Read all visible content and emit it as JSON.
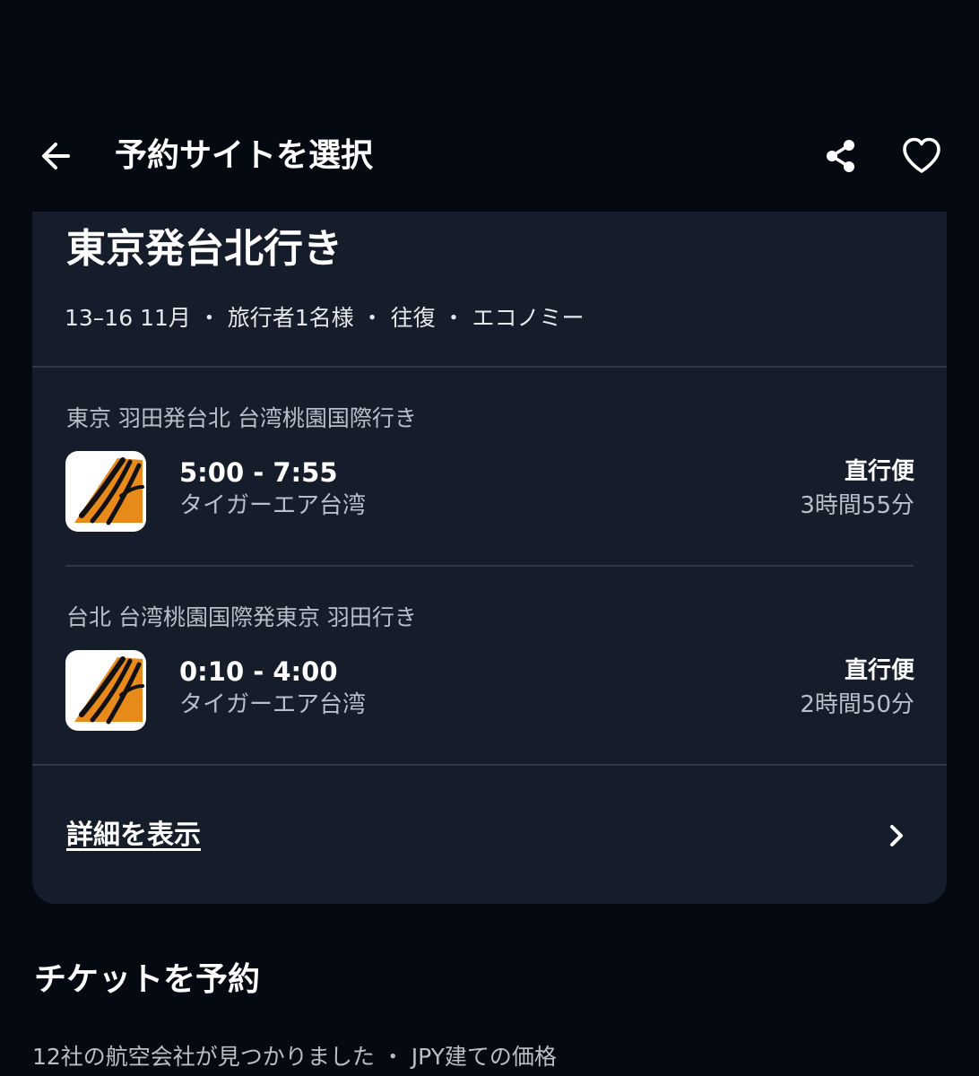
{
  "header": {
    "title": "予約サイトを選択",
    "back_icon": "arrow-left-icon",
    "share_icon": "share-icon",
    "favorite_icon": "heart-outline-icon"
  },
  "summary": {
    "route_title": "東京発台北行き",
    "meta": "13–16 11月 ・ 旅行者1名様 ・ 往復 ・ エコノミー"
  },
  "legs": [
    {
      "route": "東京 羽田発台北 台湾桃園国際行き",
      "times": "5:00 - 7:55",
      "airline": "タイガーエア台湾",
      "stops": "直行便",
      "duration": "3時間55分",
      "logo_icon": "tigerair-logo"
    },
    {
      "route": "台北 台湾桃園国際発東京 羽田行き",
      "times": "0:10 - 4:00",
      "airline": "タイガーエア台湾",
      "stops": "直行便",
      "duration": "2時間50分",
      "logo_icon": "tigerair-logo"
    }
  ],
  "details": {
    "label": "詳細を表示",
    "icon": "chevron-right-icon"
  },
  "booking": {
    "title": "チケットを予約",
    "meta": "12社の航空会社が見つかりました ・ JPY建ての価格"
  },
  "colors": {
    "background": "#050a12",
    "card": "#161d2a",
    "divider": "#2f3846",
    "muted_text": "#b9bec8",
    "tiger_orange": "#e88a1a"
  }
}
